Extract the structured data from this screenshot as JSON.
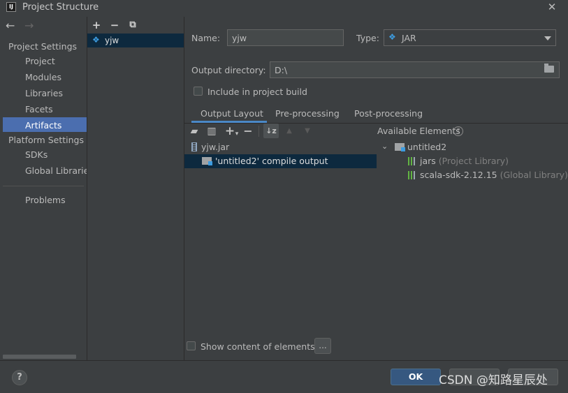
{
  "window": {
    "title": "Project Structure",
    "app_icon_text": "IJ",
    "close_glyph": "✕"
  },
  "nav": {
    "back": "←",
    "forward": "→"
  },
  "sidebar": {
    "project_settings": "Project Settings",
    "items_project": [
      "Project",
      "Modules",
      "Libraries",
      "Facets",
      "Artifacts"
    ],
    "platform_settings": "Platform Settings",
    "items_platform": [
      "SDKs",
      "Global Libraries"
    ],
    "problems": "Problems",
    "selected": "Artifacts"
  },
  "artifacts_toolbar": {
    "add": "+",
    "remove": "−",
    "copy": "⧉"
  },
  "artifacts": [
    {
      "name": "yjw",
      "icon": "artifact-diamond-icon"
    }
  ],
  "form": {
    "name_label": "Name:",
    "name_value": "yjw",
    "type_label": "Type:",
    "type_value": "JAR",
    "output_dir_label": "Output directory:",
    "output_dir_value": "D:\\",
    "include_in_build_label": "Include in project build",
    "include_in_build_checked": false
  },
  "tabs": [
    {
      "label": "Output Layout",
      "active": true
    },
    {
      "label": "Pre-processing",
      "active": false
    },
    {
      "label": "Post-processing",
      "active": false
    }
  ],
  "layout_toolbar": {
    "new_dir": "▰",
    "archive": "▥",
    "add": "+",
    "add_caret": "▾",
    "remove": "−",
    "sort": "↓z",
    "up": "▲",
    "down": "▼"
  },
  "output_tree": {
    "root": "yjw.jar",
    "children": [
      "'untitled2' compile output"
    ]
  },
  "available": {
    "label": "Available Elements",
    "help": "?",
    "root": "untitled2",
    "items": [
      {
        "name": "jars",
        "note": "(Project Library)"
      },
      {
        "name": "scala-sdk-2.12.15",
        "note": "(Global Library)"
      }
    ]
  },
  "show_content": {
    "label": "Show content of elements",
    "checked": false,
    "more_button": "..."
  },
  "buttons": {
    "ok": "OK",
    "help": "?"
  },
  "watermark": "CSDN @知路星辰处",
  "colors": {
    "accent": "#4b6eaf",
    "selection_dark": "#0d293e",
    "ok_button": "#365880",
    "background": "#3c3f41"
  }
}
